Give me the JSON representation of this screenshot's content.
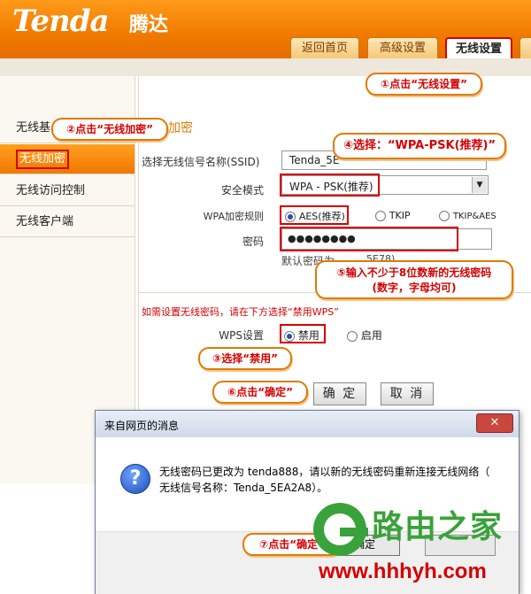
{
  "brand": {
    "logo": "Tenda",
    "logo_cn": "腾达"
  },
  "tabs": {
    "home": "返回首页",
    "advanced": "高级设置",
    "wireless": "无线设置",
    "extra": ""
  },
  "sidebar": {
    "items": [
      "无线基本设置",
      "无线加密",
      "无线访问控制",
      "无线客户端"
    ],
    "basic_visible": "无线基"
  },
  "form": {
    "section_title": "加密",
    "ssid_label": "选择无线信号名称(SSID)",
    "ssid_value": "Tenda_5E",
    "security_label": "安全模式",
    "security_value": "WPA - PSK(推荐)",
    "wpa_rule_label": "WPA加密规则",
    "wpa_options": [
      "AES(推荐)",
      "TKIP",
      "TKIP&AES"
    ],
    "password_label": "密码",
    "password_value": "●●●●●●●●",
    "default_pwd_hint": "默认密码为",
    "default_pwd_tail": "5E78)",
    "wps_note": "如需设置无线密码，请在下方选择“禁用WPS”",
    "wps_label": "WPS设置",
    "wps_options": [
      "禁用",
      "启用"
    ],
    "ok_button": "确 定",
    "cancel_button": "取 消"
  },
  "callouts": {
    "c1": "①点击“无线设置”",
    "c2": "②点击“无线加密”",
    "c3": "③选择“禁用”",
    "c4": "④选择：“WPA-PSK(推荐)”",
    "c5_line1": "⑤输入不少于8位数新的无线密码",
    "c5_line2": "(数字，字母均可)",
    "c6": "⑥点击“确定”",
    "c7": "⑦点击“确定”"
  },
  "dialog": {
    "title": "来自网页的消息",
    "close_icon": "✕",
    "message_line1": "无线密码已更改为 tenda888，请以新的无线密码重新连接无线网络（",
    "message_line2": "无线信号名称：Tenda_5EA2A8）。",
    "ok_button": "确定"
  },
  "watermark": {
    "name": "路由之家",
    "url": "www.hhhyh.com"
  },
  "colors": {
    "accent": "#f07a00",
    "highlight": "#d40000",
    "watermark": "#3aa23a"
  }
}
